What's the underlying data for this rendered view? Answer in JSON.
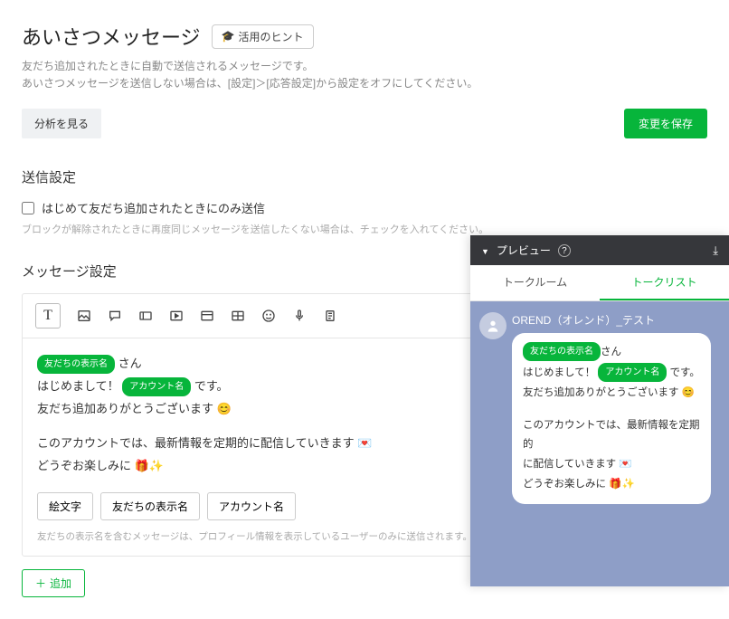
{
  "header": {
    "title": "あいさつメッセージ",
    "hint_button": "活用のヒント",
    "sub1": "友だち追加されたときに自動で送信されるメッセージです。",
    "sub2": "あいさつメッセージを送信しない場合は、[設定]＞[応答設定]から設定をオフにしてください。"
  },
  "actions": {
    "analytics": "分析を見る",
    "save": "変更を保存"
  },
  "send_settings": {
    "title": "送信設定",
    "checkbox_label": "はじめて友だち追加されたときにのみ送信",
    "hint": "ブロックが解除されたときに再度同じメッセージを送信したくない場合は、チェックを入れてください。"
  },
  "message_settings": {
    "title": "メッセージ設定"
  },
  "pills": {
    "friend_name": "友だちの表示名",
    "account_name": "アカウント名"
  },
  "body": {
    "line1_suffix": " さん",
    "line2_prefix": "はじめまして！ ",
    "line2_suffix": " です。",
    "line3": "友だち追加ありがとうございます ",
    "line3_emoji": "😊",
    "line4": "このアカウントでは、最新情報を定期的に配信していきます ",
    "line4_emoji": "💌",
    "line5": "どうぞお楽しみに ",
    "line5_emoji": "🎁✨"
  },
  "insert": {
    "emoji": "絵文字",
    "friend_name": "友だちの表示名",
    "account_name": "アカウント名",
    "note": "友だちの表示名を含むメッセージは、プロフィール情報を表示しているユーザーのみに送信されます。"
  },
  "add_button": "追加",
  "preview": {
    "title": "プレビュー",
    "tab_room": "トークルーム",
    "tab_list": "トークリスト",
    "account_display": "OREND（オレンド）_テスト",
    "bubble": {
      "line1_suffix": "さん",
      "line2_prefix": "はじめまして！ ",
      "line2_suffix": " です。",
      "line3": "友だち追加ありがとうございます ",
      "line3_emoji": "😊",
      "line4a": "このアカウントでは、最新情報を定期的",
      "line4b": "に配信していきます ",
      "line4_emoji": "💌",
      "line5": "どうぞお楽しみに ",
      "line5_emoji": "🎁✨"
    }
  }
}
